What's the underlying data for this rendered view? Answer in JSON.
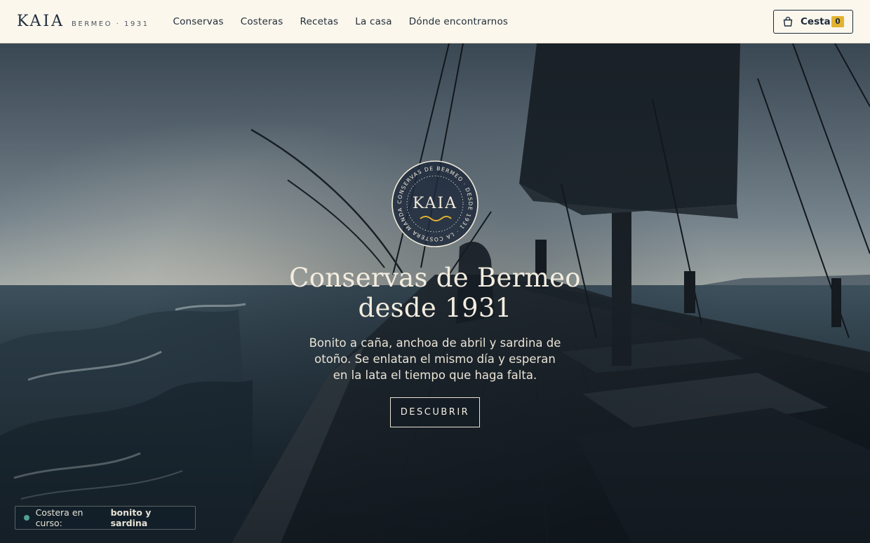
{
  "brand": {
    "name": "KAIA",
    "tagline": "BERMEO · 1931"
  },
  "nav": {
    "items": [
      {
        "label": "Conservas"
      },
      {
        "label": "Costeras"
      },
      {
        "label": "Recetas"
      },
      {
        "label": "La casa"
      },
      {
        "label": "Dónde encontrarnos"
      }
    ]
  },
  "cart": {
    "label": "Cesta",
    "count": "0",
    "icon": "basket-icon"
  },
  "hero": {
    "seal": {
      "name": "KAIA",
      "ring_text": "CONSERVAS DE BERMEO · DESDE 1931 · LA COSTERA MANDA · "
    },
    "title_line1": "Conservas de Bermeo",
    "title_line2": "desde 1931",
    "text": "Bonito a caña, anchoa de abril y sardina de otoño. Se enlatan el mismo día y esperan en la lata el tiempo que haga falta.",
    "cta_label": "DESCUBRIR"
  },
  "status": {
    "label": "Costera en curso:",
    "value": "bonito y sardina"
  },
  "colors": {
    "header_bg": "#fbf7ec",
    "navy": "#1c2a3c",
    "accent_gold": "#e3b32f",
    "status_dot": "#4fa28f"
  }
}
